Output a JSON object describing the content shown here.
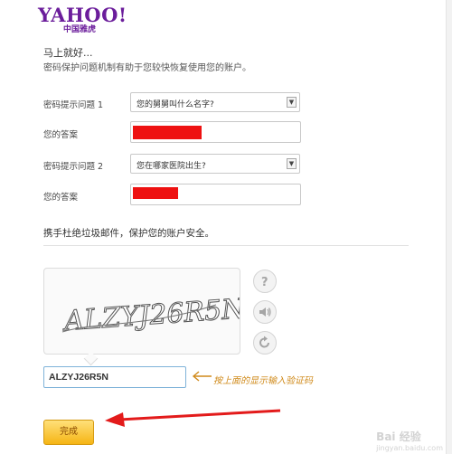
{
  "logo": {
    "main": "YAHOO!",
    "sub": "中国雅虎"
  },
  "greeting": {
    "title": "马上就好...",
    "description": "密码保护问题机制有助于您较快恢复使用您的账户。"
  },
  "security": {
    "q1_label": "密码提示问题 1",
    "q1_value": "您的舅舅叫什么名字?",
    "answer1_label": "您的答案",
    "q2_label": "密码提示问题 2",
    "q2_value": "您在哪家医院出生?",
    "answer2_label": "您的答案",
    "redaction_color": "#ee1111"
  },
  "antispam": {
    "title": "携手杜绝垃圾邮件，保护您的账户安全。"
  },
  "captcha": {
    "image_text": "ALZYJ26R5N",
    "entered_value": "ALZYJ26R5N",
    "hint": "按上面的显示输入验证码",
    "hint_color": "#d08a1a",
    "icons": [
      "help-icon",
      "audio-icon",
      "refresh-icon"
    ]
  },
  "submit_label": "完成",
  "annotation": {
    "arrow_color": "#e31b1b"
  },
  "watermark": {
    "text": "Bai 经验",
    "url": "jingyan.baidu.com"
  }
}
